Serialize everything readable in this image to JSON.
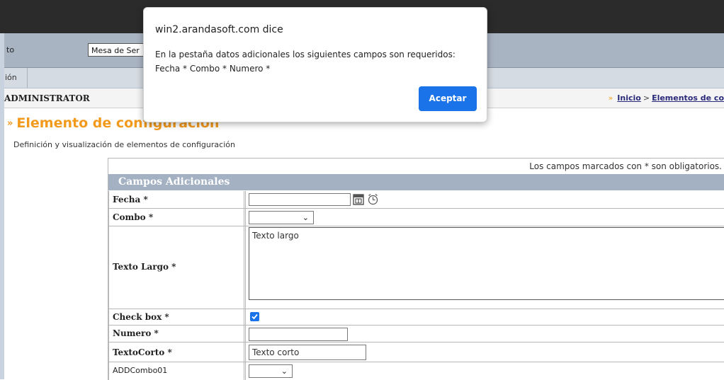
{
  "toolbar": {
    "label_partial": "to",
    "project_select_value": "Mesa de Ser"
  },
  "tabs": [
    {
      "label": "ión"
    }
  ],
  "userbar": {
    "username": "ADMINISTRATOR",
    "breadcrumb": {
      "arrow": "»",
      "home": "Inicio",
      "separator": ">",
      "current": "Elementos de co"
    }
  },
  "page": {
    "arrow": "»",
    "title": "Elemento de configuración",
    "subtitle": "Definición y visualización de elementos de configuración"
  },
  "form": {
    "required_note": "Los campos marcados con * son obligatorios.",
    "section_title": "Campos Adicionales",
    "fields": {
      "fecha": {
        "label": "Fecha *",
        "value": ""
      },
      "combo": {
        "label": "Combo *",
        "value": ""
      },
      "texto_largo": {
        "label": "Texto Largo *",
        "value": "Texto largo"
      },
      "check_box": {
        "label": "Check box *",
        "checked": true
      },
      "numero": {
        "label": "Numero *",
        "value": ""
      },
      "texto_corto": {
        "label": "TextoCorto *",
        "value": "Texto corto"
      },
      "addcombo01": {
        "label": "ADDCombo01",
        "value": ""
      }
    }
  },
  "dialog": {
    "title": "win2.arandasoft.com dice",
    "message_line1": "En la pestaña datos adicionales los siguientes campos son requeridos:",
    "message_line2": "Fecha * Combo * Numero *",
    "ok_label": "Aceptar"
  },
  "colors": {
    "title_orange": "#f29a1c",
    "section_header": "#a3b1c2",
    "dialog_button": "#1a73e8",
    "link": "#2a2a7a"
  },
  "icons": [
    "calendar-icon",
    "clock-icon",
    "chevron-down-icon",
    "checkbox-checked-icon"
  ]
}
